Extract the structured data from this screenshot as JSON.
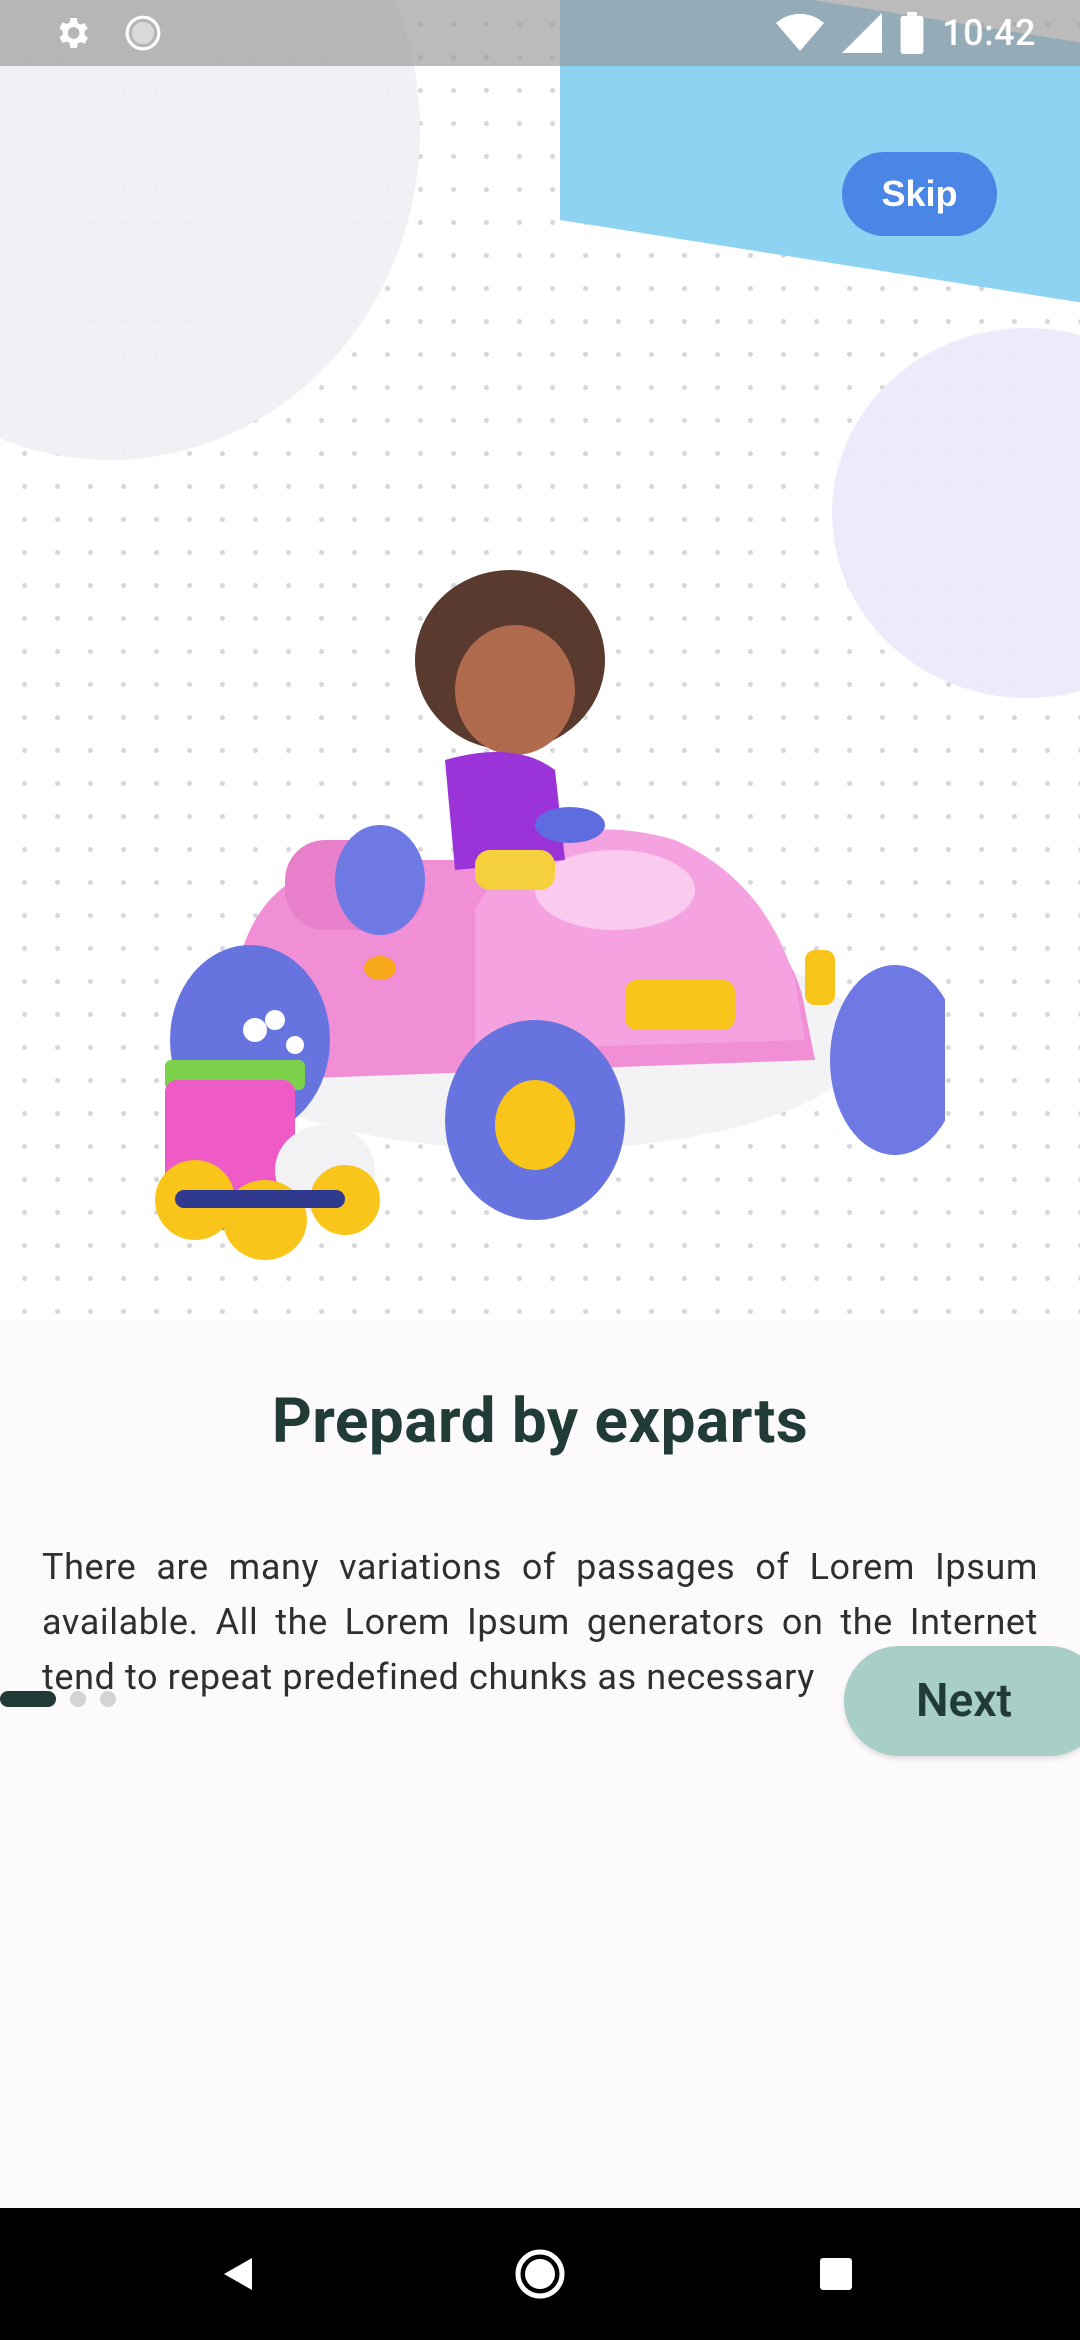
{
  "status_bar": {
    "time": "10:42",
    "icons": [
      "settings-icon",
      "circle-status-icon",
      "wifi-icon",
      "signal-icon",
      "battery-icon"
    ]
  },
  "onboarding": {
    "skip_label": "Skip",
    "title": "Prepard by exparts",
    "body": "There are many variations of passages of Lorem Ipsum available. All the Lorem Ipsum generators on the Internet tend to repeat predefined chunks as necessary",
    "next_label": "Next",
    "page_indicator": {
      "total": 3,
      "current": 1
    }
  },
  "nav_bar": {
    "icons": [
      "back-icon",
      "home-icon",
      "recents-icon"
    ]
  },
  "colors": {
    "accent_skip": "#4a86e6",
    "next_button": "#a8cfc6",
    "title_text": "#213b37"
  }
}
